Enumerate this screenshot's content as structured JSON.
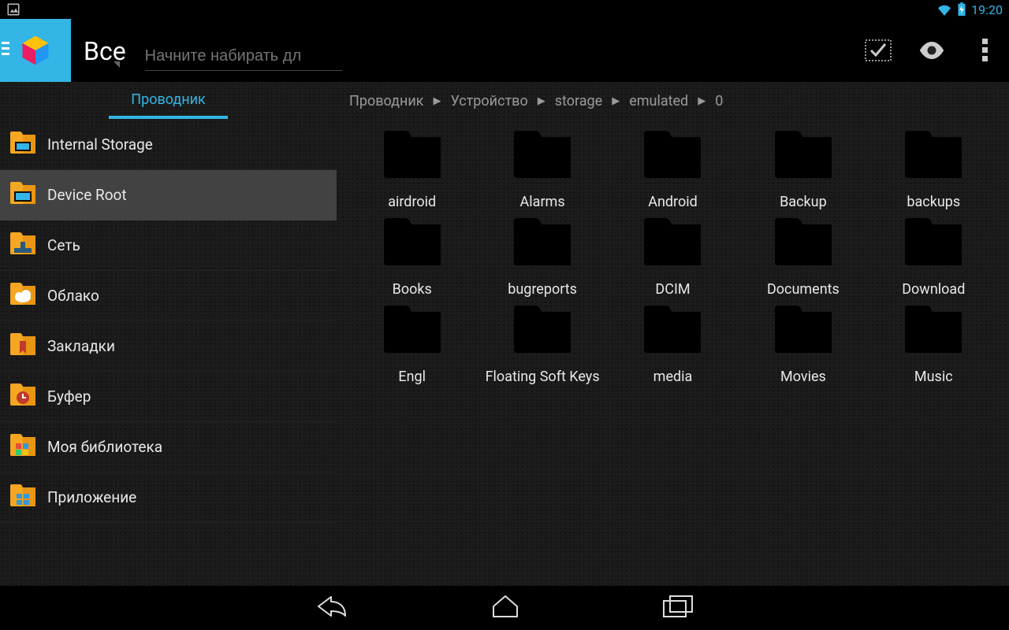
{
  "statusbar": {
    "time": "19:20"
  },
  "header": {
    "title": "Все",
    "search_placeholder": "Начните набирать дл"
  },
  "sidebar": {
    "tab": "Проводник",
    "items": [
      {
        "label": "Internal Storage",
        "key": "internal-storage"
      },
      {
        "label": "Device Root",
        "key": "device-root"
      },
      {
        "label": "Сеть",
        "key": "network"
      },
      {
        "label": "Облако",
        "key": "cloud"
      },
      {
        "label": "Закладки",
        "key": "bookmarks"
      },
      {
        "label": "Буфер",
        "key": "clipboard"
      },
      {
        "label": "Моя библиотека",
        "key": "my-library"
      },
      {
        "label": "Приложение",
        "key": "application"
      }
    ],
    "selected_index": 1
  },
  "breadcrumb": [
    "Проводник",
    "Устройство",
    "storage",
    "emulated",
    "0"
  ],
  "folders": [
    "airdroid",
    "Alarms",
    "Android",
    "Backup",
    "backups",
    "Books",
    "bugreports",
    "DCIM",
    "Documents",
    "Download",
    "Engl",
    "Floating Soft Keys",
    "media",
    "Movies",
    "Music"
  ]
}
